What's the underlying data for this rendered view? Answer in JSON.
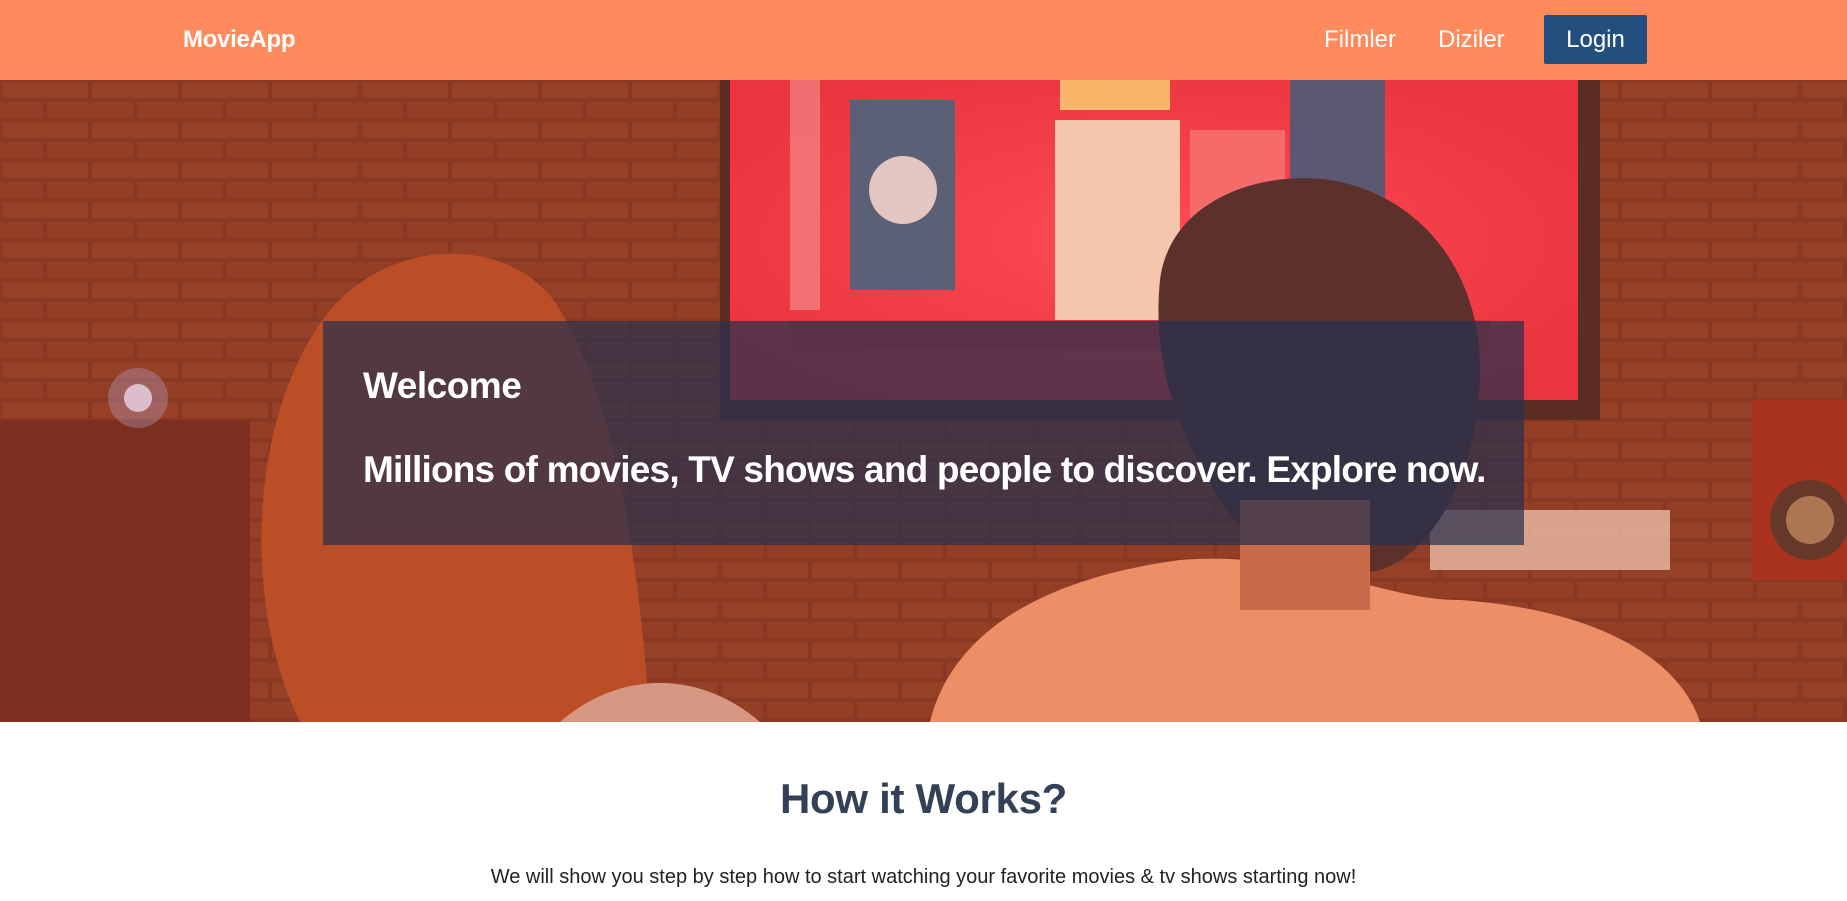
{
  "navbar": {
    "brand": "MovieApp",
    "links": [
      "Filmler",
      "Diziler"
    ],
    "login_label": "Login",
    "background": "#ff8a5c",
    "login_color": "#234f7f"
  },
  "hero": {
    "title": "Welcome",
    "subtitle": "Millions of movies, TV shows and people to discover. Explore now.",
    "box_color": "#28304e"
  },
  "how_it_works": {
    "title": "How it Works?",
    "description": "We will show you step by step how to start watching your favorite movies & tv shows starting now!"
  }
}
